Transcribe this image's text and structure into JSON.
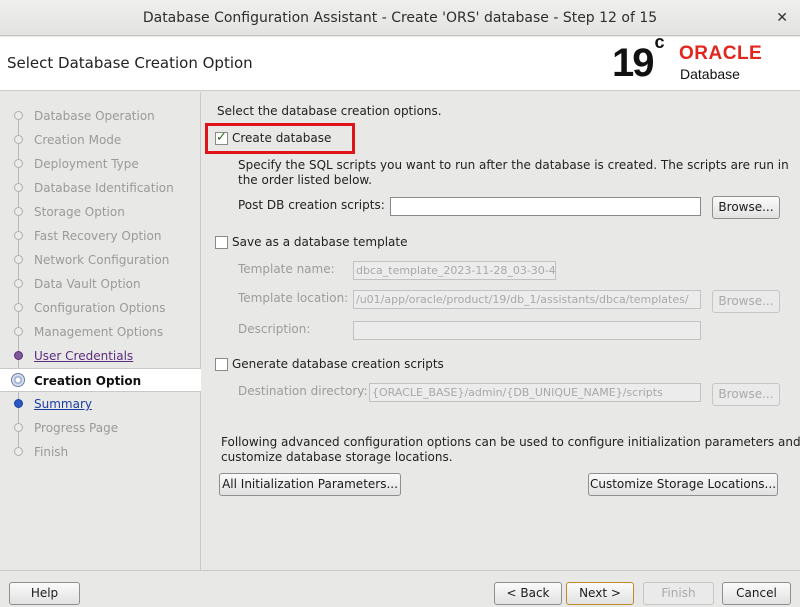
{
  "window": {
    "title": "Database Configuration Assistant - Create 'ORS' database - Step 12 of 15",
    "close_glyph": "✕"
  },
  "header": {
    "page_title": "Select Database Creation Option",
    "logo_version": "19",
    "logo_version_sup": "c",
    "logo_brand": "ORACLE",
    "logo_product": "Database"
  },
  "steps": [
    {
      "label": "Database Operation",
      "state": "pending"
    },
    {
      "label": "Creation Mode",
      "state": "pending"
    },
    {
      "label": "Deployment Type",
      "state": "pending"
    },
    {
      "label": "Database Identification",
      "state": "pending"
    },
    {
      "label": "Storage Option",
      "state": "pending"
    },
    {
      "label": "Fast Recovery Option",
      "state": "pending"
    },
    {
      "label": "Network Configuration",
      "state": "pending"
    },
    {
      "label": "Data Vault Option",
      "state": "pending"
    },
    {
      "label": "Configuration Options",
      "state": "pending"
    },
    {
      "label": "Management Options",
      "state": "pending"
    },
    {
      "label": "User Credentials",
      "state": "done"
    },
    {
      "label": "Creation Option",
      "state": "current"
    },
    {
      "label": "Summary",
      "state": "link"
    },
    {
      "label": "Progress Page",
      "state": "pending"
    },
    {
      "label": "Finish",
      "state": "pending"
    }
  ],
  "main": {
    "intro": "Select the database creation options.",
    "create_db": {
      "label": "Create database",
      "checked": true,
      "desc_line1": "Specify the SQL scripts you want to run after the database is created. The scripts are run in",
      "desc_line2": "the order listed below.",
      "post_scripts_label": "Post DB creation scripts:",
      "post_scripts_value": "",
      "browse": "Browse..."
    },
    "template": {
      "label": "Save as a database template",
      "checked": false,
      "name_label": "Template name:",
      "name_value": "dbca_template_2023-11-28_03-30-4",
      "location_label": "Template location:",
      "location_value": "/u01/app/oracle/product/19/db_1/assistants/dbca/templates/",
      "browse": "Browse...",
      "desc_label": "Description:",
      "desc_value": ""
    },
    "scripts": {
      "label": "Generate database creation scripts",
      "checked": false,
      "dest_label": "Destination directory:",
      "dest_value": "{ORACLE_BASE}/admin/{DB_UNIQUE_NAME}/scripts",
      "browse": "Browse..."
    },
    "advanced_line1": "Following advanced configuration options can be used to configure initialization parameters and",
    "advanced_line2": "customize database storage locations.",
    "init_params_button": "All Initialization Parameters...",
    "storage_button": "Customize Storage Locations..."
  },
  "footer": {
    "help": "Help",
    "back": "< Back",
    "next": "Next >",
    "finish": "Finish",
    "cancel": "Cancel"
  },
  "colors": {
    "highlight": "#e0131a",
    "oracle_red": "#e2261d",
    "visited_step": "#5d2b7f",
    "link_step": "#1a3fa0"
  }
}
